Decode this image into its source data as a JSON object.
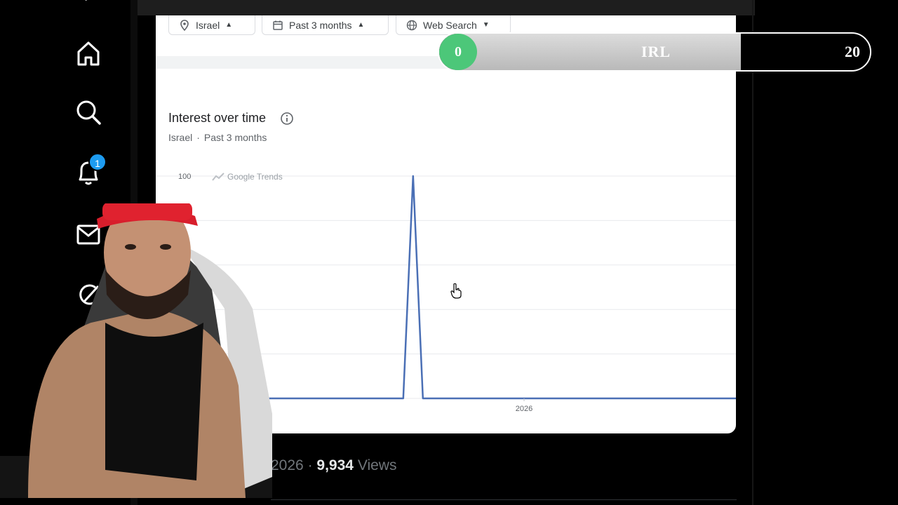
{
  "sidebar": {
    "items": [
      {
        "name": "home",
        "icon": "home-icon"
      },
      {
        "name": "explore",
        "icon": "search-icon"
      },
      {
        "name": "notifications",
        "icon": "bell-icon",
        "badge": "1"
      },
      {
        "name": "messages",
        "icon": "mail-icon"
      },
      {
        "name": "grok",
        "icon": "grok-icon"
      }
    ]
  },
  "filters": {
    "location": "Israel",
    "time_range": "Past 3 months",
    "property": "Web Search"
  },
  "section": {
    "title": "Interest over time",
    "subtitle_location": "Israel",
    "subtitle_separator": "·",
    "subtitle_range": "Past 3 months"
  },
  "chart_data": {
    "type": "line",
    "brand": "Google Trends",
    "y_tick_labels": [
      "100"
    ],
    "x_tick_labels": [
      "2026"
    ],
    "ylim": [
      0,
      100
    ],
    "grid": true,
    "series": [
      {
        "values": [
          0,
          0,
          0,
          0,
          0,
          0,
          0,
          0,
          0,
          0,
          100,
          0,
          0,
          0,
          0,
          0,
          0,
          0,
          0,
          0,
          0,
          0,
          0,
          0,
          0,
          0
        ]
      }
    ],
    "color": "#4a6fb5"
  },
  "overlay": {
    "current": "0",
    "label": "IRL",
    "max": "20",
    "progress_fraction": 0.0,
    "accent": "#4cc779"
  },
  "post": {
    "date_fragment": "2026",
    "separator": "·",
    "views_count": "9,934",
    "views_label": "Views"
  }
}
